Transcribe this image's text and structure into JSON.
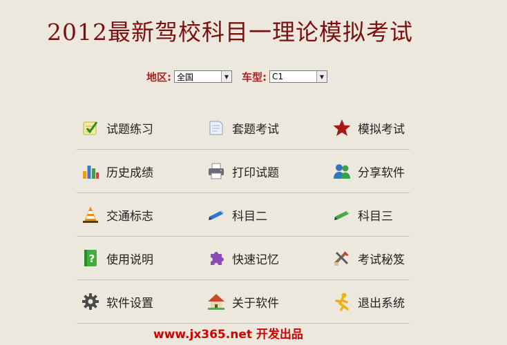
{
  "title": "2012最新驾校科目一理论模拟考试",
  "filters": {
    "region_label": "地区:",
    "region_value": "全国",
    "cartype_label": "车型:",
    "cartype_value": "C1"
  },
  "menu": {
    "rows": [
      [
        {
          "label": "试题练习",
          "icon": "notepad-icon"
        },
        {
          "label": "套题考试",
          "icon": "paper-icon"
        },
        {
          "label": "模拟考试",
          "icon": "star-icon"
        }
      ],
      [
        {
          "label": "历史成绩",
          "icon": "bar-chart-icon"
        },
        {
          "label": "打印试题",
          "icon": "printer-icon"
        },
        {
          "label": "分享软件",
          "icon": "users-icon"
        }
      ],
      [
        {
          "label": "交通标志",
          "icon": "traffic-cone-icon"
        },
        {
          "label": "科目二",
          "icon": "blue-pen-icon"
        },
        {
          "label": "科目三",
          "icon": "green-pen-icon"
        }
      ],
      [
        {
          "label": "使用说明",
          "icon": "help-icon"
        },
        {
          "label": "快速记忆",
          "icon": "puzzle-icon"
        },
        {
          "label": "考试秘笈",
          "icon": "tools-icon"
        }
      ],
      [
        {
          "label": "软件设置",
          "icon": "gear-icon"
        },
        {
          "label": "关于软件",
          "icon": "house-icon"
        },
        {
          "label": "退出系统",
          "icon": "running-man-icon"
        }
      ]
    ]
  },
  "footer": {
    "text": "www.jx365.net 开发出品"
  },
  "colors": {
    "background": "#ede8dd",
    "title": "#7a1010",
    "label": "#b21f1f",
    "footer": "#d10000"
  }
}
